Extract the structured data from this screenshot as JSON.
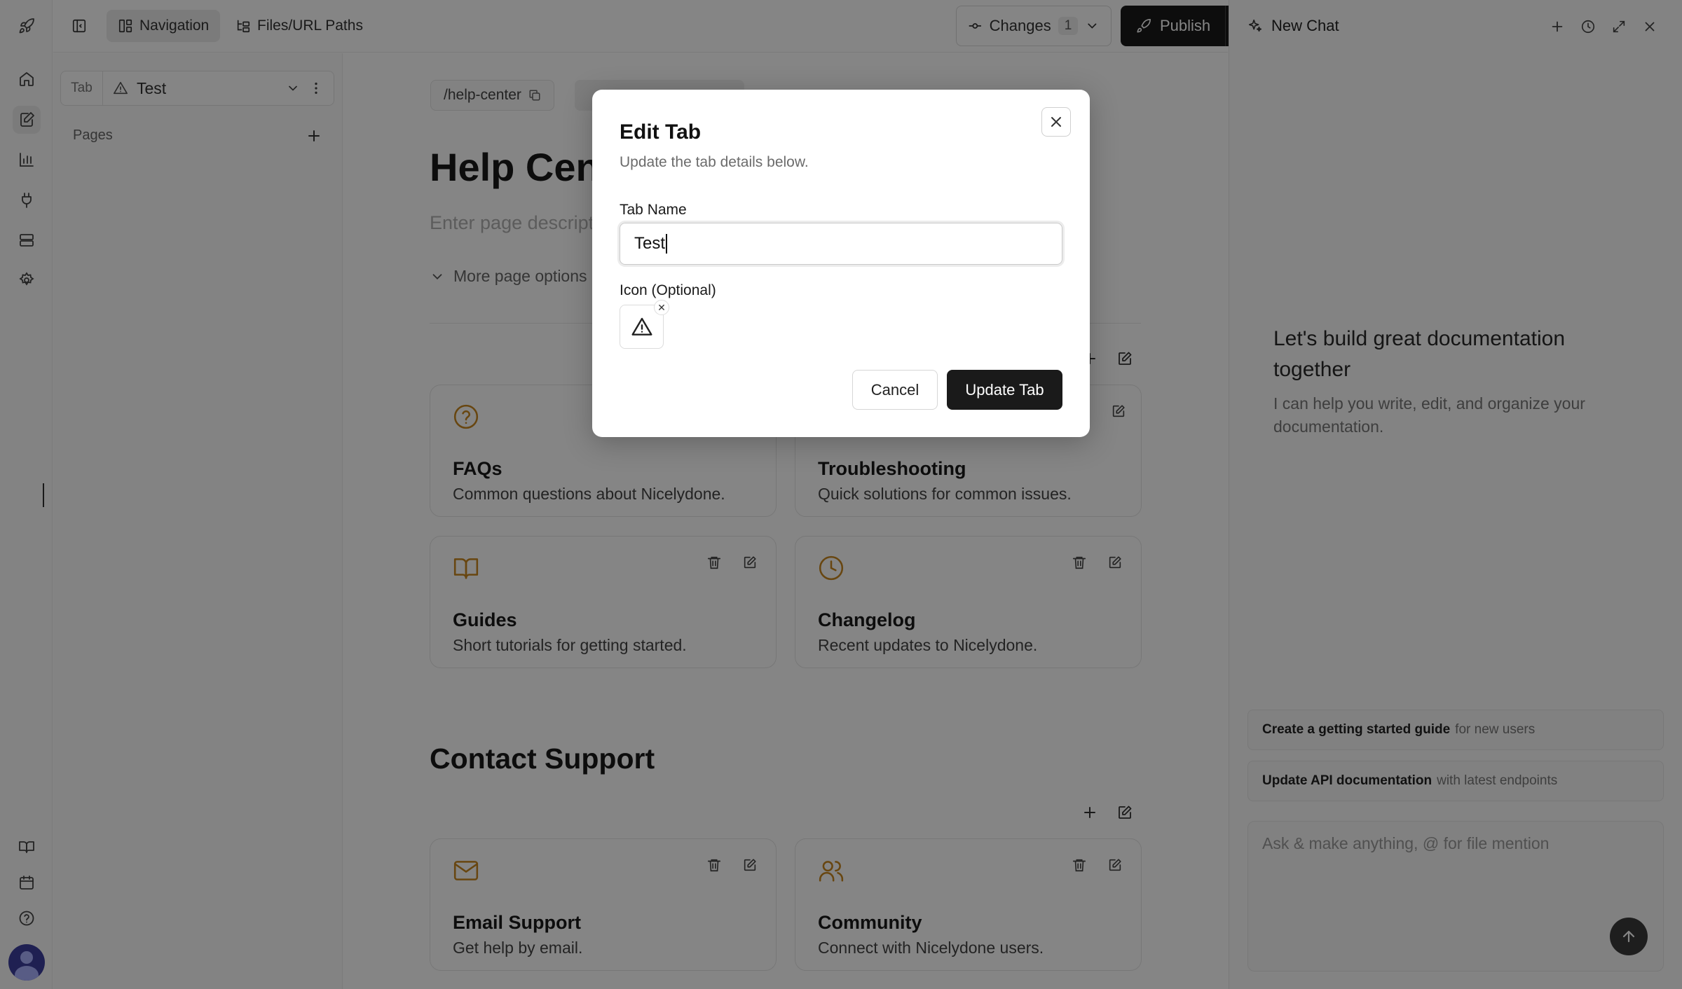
{
  "topbar": {
    "tabs": [
      {
        "label": "Navigation",
        "icon": "layout-icon",
        "active": true
      },
      {
        "label": "Files/URL Paths",
        "icon": "folder-tree-icon",
        "active": false
      }
    ],
    "changes_label": "Changes",
    "changes_count": "1",
    "publish_label": "Publish"
  },
  "sidebar": {
    "tab_tag": "Tab",
    "tab_name": "Test",
    "pages_label": "Pages"
  },
  "main": {
    "path": "/help-center",
    "title": "Help Cent",
    "description_placeholder": "Enter page descript",
    "more_options": "More page options",
    "cards": [
      {
        "icon": "help-circle-icon",
        "title": "FAQs",
        "desc": "Common questions about Nicelydone."
      },
      {
        "icon": "wrench-icon",
        "title": "Troubleshooting",
        "desc": "Quick solutions for common issues."
      },
      {
        "icon": "book-icon",
        "title": "Guides",
        "desc": "Short tutorials for getting started."
      },
      {
        "icon": "clock-icon",
        "title": "Changelog",
        "desc": "Recent updates to Nicelydone."
      }
    ],
    "contact_title": "Contact Support",
    "contact_cards": [
      {
        "icon": "mail-icon",
        "title": "Email Support",
        "desc": "Get help by email."
      },
      {
        "icon": "users-icon",
        "title": "Community",
        "desc": "Connect with Nicelydone users."
      }
    ]
  },
  "chat": {
    "title": "New Chat",
    "hero_title": "Let's build great documentation together",
    "hero_sub": "I can help you write, edit, and organize your documentation.",
    "suggestions": [
      {
        "bold": "Create a getting started guide",
        "rest": "for new users"
      },
      {
        "bold": "Update API documentation",
        "rest": "with latest endpoints"
      }
    ],
    "input_placeholder": "Ask & make anything, @ for file mention"
  },
  "modal": {
    "title": "Edit Tab",
    "subtitle": "Update the tab details below.",
    "name_label": "Tab Name",
    "name_value": "Test",
    "icon_label": "Icon (Optional)",
    "selected_icon": "alert-triangle-icon",
    "cancel_label": "Cancel",
    "update_label": "Update Tab"
  },
  "colors": {
    "accent": "#c8871f",
    "primary_button": "#1a1a1a"
  }
}
